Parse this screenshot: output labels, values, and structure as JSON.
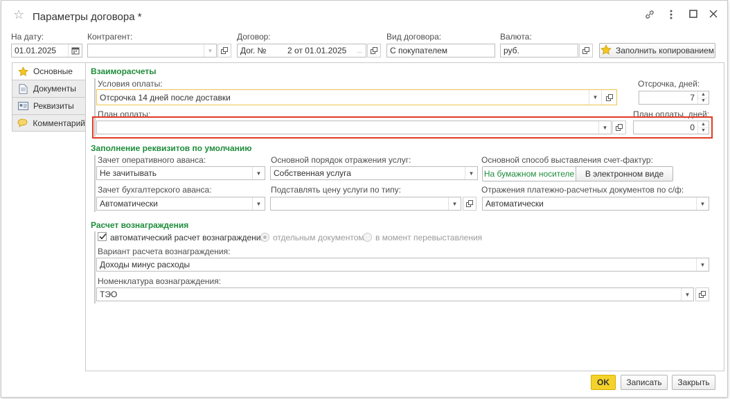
{
  "window": {
    "title": "Параметры договора *"
  },
  "header": {
    "date_label": "На дату:",
    "date_value": "01.01.2025",
    "contractor_label": "Контрагент:",
    "contractor_value": "",
    "contract_label": "Договор:",
    "contract_value_prefix": "Дог. №",
    "contract_value_suffix": "2 от 01.01.2025",
    "contract_ellipsis": "...",
    "contract_type_label": "Вид договора:",
    "contract_type_value": "С покупателем",
    "currency_label": "Валюта:",
    "currency_value": "руб.",
    "fill_copy_label": "Заполнить копированием"
  },
  "tabs": [
    {
      "label": "Основные",
      "icon": "star-icon",
      "active": true
    },
    {
      "label": "Документы",
      "icon": "document-icon",
      "active": false
    },
    {
      "label": "Реквизиты",
      "icon": "id-card-icon",
      "active": false
    },
    {
      "label": "Комментарий",
      "icon": "comment-icon",
      "active": false
    }
  ],
  "settlements": {
    "section_title": "Взаиморасчеты",
    "payment_terms_label": "Условия оплаты:",
    "payment_terms_value": "Отсрочка 14 дней после доставки",
    "delay_label": "Отсрочка, дней:",
    "delay_value": "7",
    "payment_plan_label": "План оплаты:",
    "payment_plan_value": "",
    "plan_days_label": "План оплаты, дней:",
    "plan_days_value": "0"
  },
  "defaults": {
    "section_title": "Заполнение реквизитов по умолчанию",
    "advance_label": "Зачет оперативного аванса:",
    "advance_value": "Не зачитывать",
    "service_order_label": "Основной порядок отражения услуг:",
    "service_order_value": "Собственная услуга",
    "invoice_method_label": "Основной способ выставления счет-фактур:",
    "invoice_paper": "На бумажном носителе",
    "invoice_electronic": "В электронном виде",
    "acc_advance_label": "Зачет бухгалтерского аванса:",
    "acc_advance_value": "Автоматически",
    "price_type_label": "Подставлять цену услуги по типу:",
    "price_type_value": "",
    "payment_docs_label": "Отражения платежно-расчетных документов по с/ф:",
    "payment_docs_value": "Автоматически"
  },
  "reward": {
    "section_title": "Расчет вознаграждения",
    "auto_calc_label": "автоматический расчет вознаграждения",
    "auto_calc_checked": true,
    "option_separate": "отдельным документом",
    "option_rebill": "в момент перевыставления",
    "variant_label": "Вариант расчета вознаграждения:",
    "variant_value": "Доходы минус расходы",
    "nomenclature_label": "Номенклатура вознаграждения:",
    "nomenclature_value": "ТЭО"
  },
  "footer": {
    "ok": "OK",
    "save": "Записать",
    "close": "Закрыть"
  },
  "colors": {
    "accent_green": "#1e8c3a",
    "ok_yellow": "#f5d22a",
    "highlight_red": "#e03b24",
    "highlight_yellow": "#ecc34b"
  }
}
